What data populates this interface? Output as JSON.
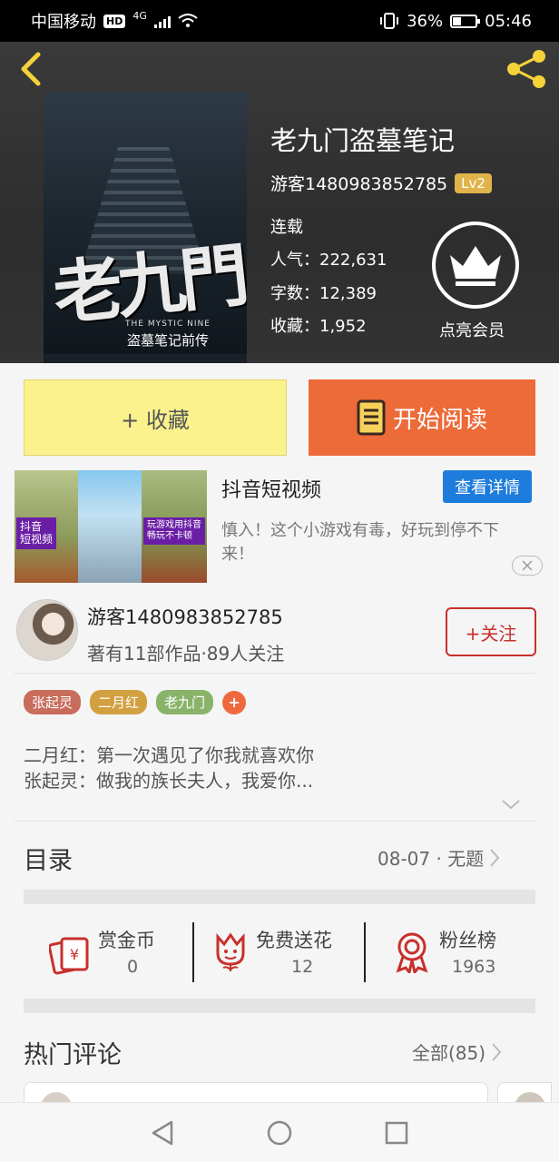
{
  "status_bar": {
    "carrier": "中国移动",
    "hd": "HD",
    "network": "4G",
    "battery_percent": "36%",
    "battery_level": 0.36,
    "time": "05:46"
  },
  "book": {
    "title": "老九门盗墓笔记",
    "author": "游客1480983852785",
    "level": "Lv2",
    "status": "连载",
    "popularity": "人气：222,631",
    "word_count": "字数：12,389",
    "favorites": "收藏：1,952",
    "vip_label": "点亮会员",
    "cover_art_title": "老九門",
    "cover_subtitle_en": "THE MYSTIC NINE",
    "cover_subtitle_cn": "盗墓笔记前传"
  },
  "actions": {
    "favorite_label": "+ 收藏",
    "read_label": "开始阅读"
  },
  "ad": {
    "title": "抖音短视频",
    "detail_button": "查看详情",
    "description": "慎入！这个小游戏有毒，好玩到停不下来！",
    "tag_left": "抖音\n短视频",
    "tag_right": "玩游戏用抖音\n畅玩不卡顿"
  },
  "author_card": {
    "name": "游客1480983852785",
    "summary": "著有11部作品·89人关注",
    "follow_label": "+关注"
  },
  "tags": [
    {
      "label": "张起灵",
      "color": "#c86c5c"
    },
    {
      "label": "二月红",
      "color": "#d2a040"
    },
    {
      "label": "老九门",
      "color": "#8ab36a"
    }
  ],
  "intro": {
    "line1": "二月红：第一次遇见了你我就喜欢你",
    "line2": "张起灵：做我的族长夫人，我爱你..."
  },
  "toc": {
    "title": "目录",
    "latest": "08-07 · 无题"
  },
  "stats": [
    {
      "label": "赏金币",
      "value": "0",
      "icon": "coin-envelope-icon"
    },
    {
      "label": "免费送花",
      "value": "12",
      "icon": "flower-icon"
    },
    {
      "label": "粉丝榜",
      "value": "1963",
      "icon": "medal-icon"
    }
  ],
  "comments": {
    "title": "热门评论",
    "all_label": "全部(85)"
  },
  "colors": {
    "accent_orange": "#ed6a39",
    "favorite_yellow": "#fbf28d",
    "follow_red": "#c8302c",
    "detail_blue": "#1e7ddc",
    "icon_red": "#c8302c",
    "level_gold": "#e0b44a"
  }
}
